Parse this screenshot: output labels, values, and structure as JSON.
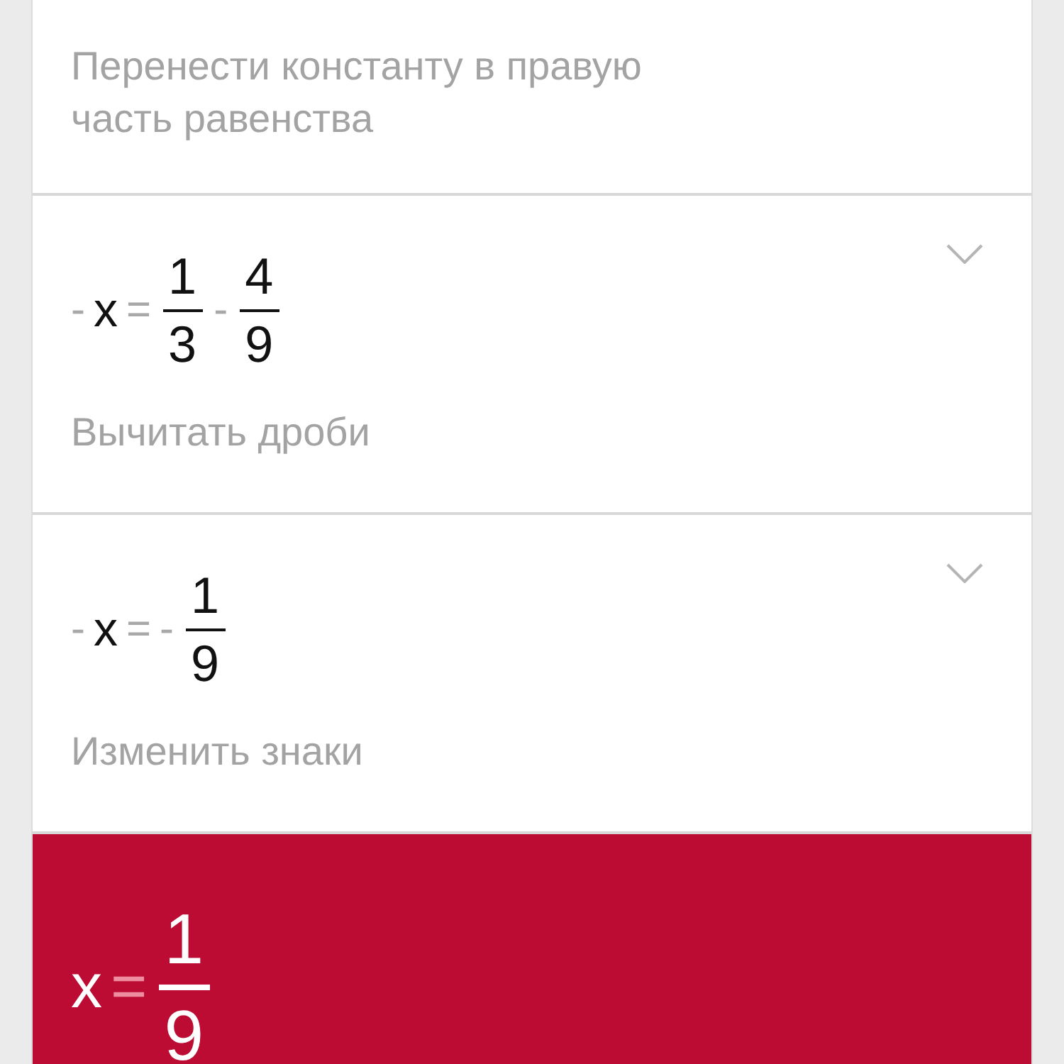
{
  "steps": [
    {
      "description": "Перенести константу в правую часть равенства",
      "expandable": false
    },
    {
      "equation": [
        {
          "kind": "op",
          "text": "-"
        },
        {
          "kind": "var",
          "text": "x"
        },
        {
          "kind": "op",
          "text": "="
        },
        {
          "kind": "frac",
          "num": "1",
          "den": "3"
        },
        {
          "kind": "op",
          "text": "-"
        },
        {
          "kind": "frac",
          "num": "4",
          "den": "9"
        }
      ],
      "description": "Вычитать дроби",
      "expandable": true
    },
    {
      "equation": [
        {
          "kind": "op",
          "text": "-"
        },
        {
          "kind": "var",
          "text": "x"
        },
        {
          "kind": "op",
          "text": "="
        },
        {
          "kind": "op",
          "text": "-"
        },
        {
          "kind": "frac",
          "num": "1",
          "den": "9"
        }
      ],
      "description": "Изменить знаки",
      "expandable": true
    }
  ],
  "result": {
    "equation": [
      {
        "kind": "var",
        "text": "x"
      },
      {
        "kind": "op",
        "text": "="
      },
      {
        "kind": "frac",
        "num": "1",
        "den": "9"
      }
    ]
  }
}
